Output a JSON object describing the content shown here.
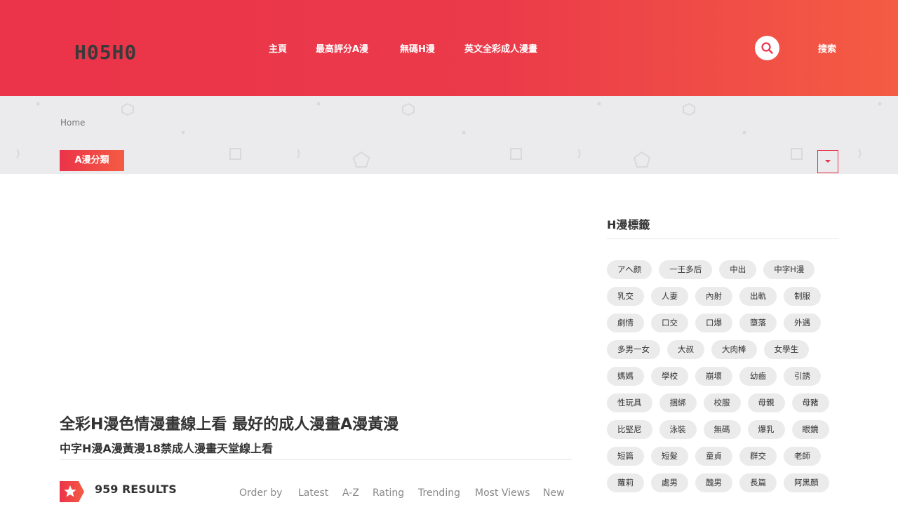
{
  "header": {
    "logo": "H05H0",
    "nav": [
      {
        "label": "主頁"
      },
      {
        "label": "最高評分A漫"
      },
      {
        "label": "無碼H漫"
      },
      {
        "label": "英文全彩成人漫畫"
      }
    ],
    "search_label": "搜索"
  },
  "breadcrumb": "Home",
  "genre_button": "A漫分類",
  "main": {
    "title": "全彩H漫色情漫畫線上看 最好的成人漫畫A漫黃漫",
    "subtitle": "中字H漫A漫黃漫18禁成人漫畫天堂線上看",
    "results": "959 RESULTS",
    "order_by": [
      "Order by",
      "Latest",
      "A-Z",
      "Rating",
      "Trending",
      "Most Views",
      "New"
    ]
  },
  "sidebar": {
    "title": "H漫標籤",
    "tag_rows": [
      [
        "アヘ颜",
        "一王多后",
        "中出",
        "中字H漫"
      ],
      [
        "乳交",
        "人妻",
        "內射",
        "出軌",
        "制服"
      ],
      [
        "劇情",
        "口交",
        "口爆",
        "墮落",
        "外遇"
      ],
      [
        "多男一女",
        "大叔",
        "大肉棒",
        "女學生"
      ],
      [
        "媽媽",
        "學校",
        "崩壞",
        "幼齒",
        "引誘"
      ],
      [
        "性玩具",
        "捆綁",
        "校服",
        "母親",
        "母豬"
      ],
      [
        "比堅尼",
        "泳裝",
        "無碼",
        "爆乳",
        "眼鏡"
      ],
      [
        "短篇",
        "短髮",
        "童貞",
        "群交",
        "老師"
      ],
      [
        "蘿莉",
        "處男",
        "醜男",
        "長篇",
        "阿黑顏"
      ]
    ]
  },
  "colors": {
    "accent_start": "#eb3349",
    "accent_end": "#f45c43"
  }
}
